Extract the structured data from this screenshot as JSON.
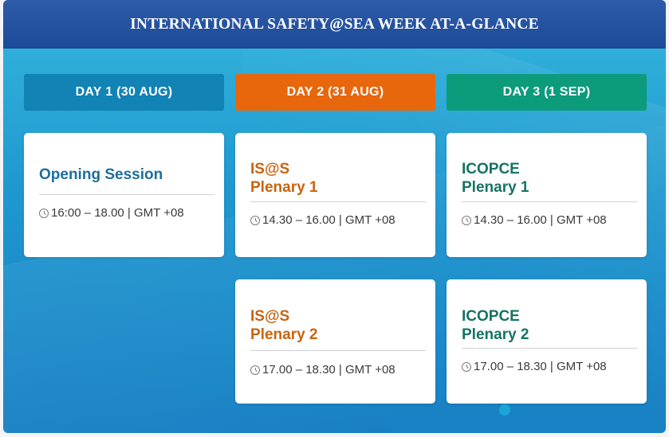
{
  "header": {
    "title": "INTERNATIONAL SAFETY@SEA WEEK AT-A-GLANCE"
  },
  "days": [
    {
      "label": "DAY 1 (30 AUG)",
      "color": "#1183b5"
    },
    {
      "label": "DAY 2 (31 AUG)",
      "color": "#e8670d"
    },
    {
      "label": "DAY 3 (1 SEP)",
      "color": "#0c9b7b"
    }
  ],
  "sessions": {
    "day1_opening": {
      "title": "Opening Session",
      "time": "16:00 – 18.00 | GMT +08",
      "color": "#1c6e9c",
      "icon": "clock-icon"
    },
    "day2_plenary1": {
      "title": "IS@S\nPlenary 1",
      "time": "14.30 – 16.00 | GMT +08",
      "color": "#c8640f",
      "icon": "clock-icon"
    },
    "day3_plenary1": {
      "title": "ICOPCE\nPlenary 1",
      "time": "14.30 – 16.00 | GMT +08",
      "color": "#167363",
      "icon": "clock-icon"
    },
    "day2_plenary2": {
      "title": "IS@S\nPlenary 2",
      "time": "17.00 – 18.30 | GMT +08",
      "color": "#c8640f",
      "icon": "clock-icon"
    },
    "day3_plenary2": {
      "title": "ICOPCE\nPlenary 2",
      "time": "17.00 – 18.30 | GMT +08",
      "color": "#167363",
      "icon": "clock-icon"
    }
  }
}
